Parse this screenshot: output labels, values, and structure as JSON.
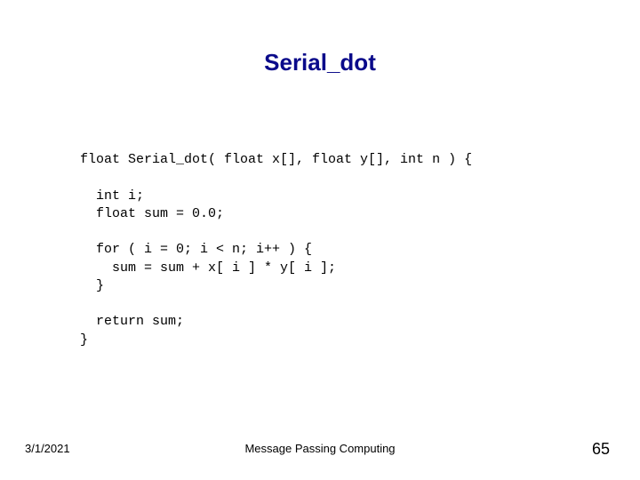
{
  "title": "Serial_dot",
  "code": "float Serial_dot( float x[], float y[], int n ) {\n\n  int i;\n  float sum = 0.0;\n\n  for ( i = 0; i < n; i++ ) {\n    sum = sum + x[ i ] * y[ i ];\n  }\n\n  return sum;\n}",
  "footer": {
    "date": "3/1/2021",
    "center": "Message Passing Computing",
    "page": "65"
  }
}
